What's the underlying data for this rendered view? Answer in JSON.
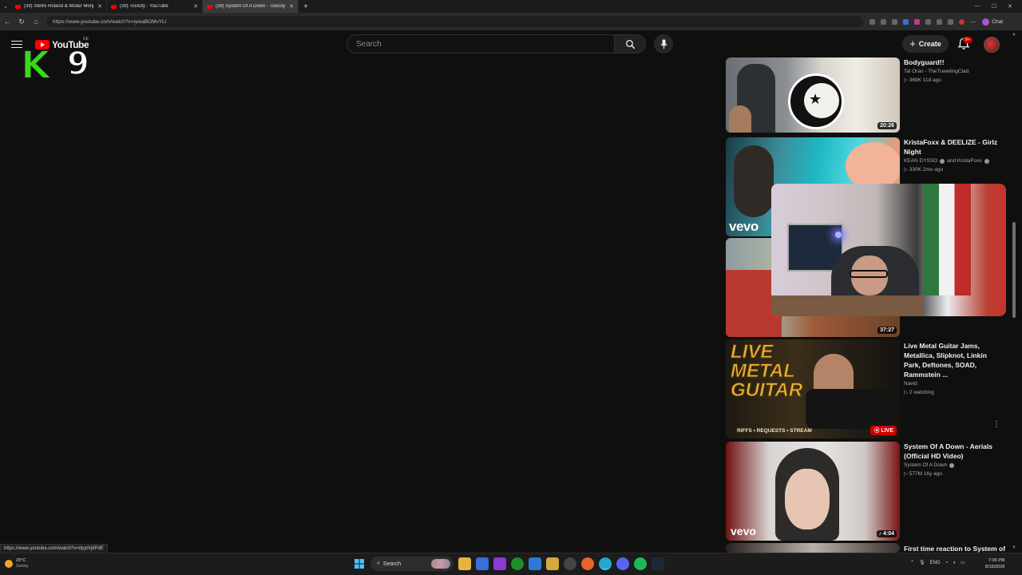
{
  "browser": {
    "tabs": [
      {
        "title": "(39) Stefre Roland & Mister Monj"
      },
      {
        "title": "(39) Toxicity - YouTube"
      },
      {
        "title": "(39) System Of A Down - Toxicity (",
        "active": true
      }
    ],
    "url": "https://www.youtube.com/watch?v=iywaBOMvYLI",
    "chat_label": "Chat"
  },
  "youtube": {
    "logo_text": "YouTube",
    "region": "DE",
    "overlay_logo": {
      "letter": "K",
      "number": "9"
    },
    "search_placeholder": "Search",
    "create_label": "Create",
    "notifications_badge": "9+"
  },
  "recommendations": [
    {
      "title": "Bodyguard!!",
      "channel": "Tal Oran - TheTravelingClatt",
      "meta": "▷ 369K  11d ago",
      "duration": "20:26"
    },
    {
      "title": "KristaFoxx & DEELIZE - Girlz Night",
      "channel": "KEAN DYSSO",
      "channel2": "and KristaFoxx",
      "meta": "▷ 330K  2mo ago",
      "thumb_text": "vevo"
    },
    {
      "title": "",
      "channel": "",
      "meta": "",
      "duration": "37:27"
    },
    {
      "title": "Live Metal Guitar Jams, Metallica, Slipknot, Linkin Park, Deftones, SOAD, Rammstein ...",
      "channel": "Navid",
      "meta": "▷ 2 watching",
      "live_label": "LIVE",
      "thumb_text": "LIVE METAL GUITAR",
      "thumb_sub": "RIFFS • REQUESTS • STREAM"
    },
    {
      "title": "System Of A Down - Aerials (Official HD Video)",
      "channel": "System Of A Down",
      "meta": "▷ 577M  16y ago",
      "duration": "♪ 4:04",
      "thumb_text": "vevo"
    },
    {
      "title": "First time reaction to System of"
    }
  ],
  "status_url": "https://www.youtube.com/watch?v=iIpytXj8PdE",
  "taskbar": {
    "weather_temp": "20°C",
    "weather_desc": "Sunny",
    "search_label": "Search",
    "lang": "ENG",
    "time": "7:05 PM",
    "date": "8/15/2026"
  },
  "colors": {
    "background": "#0f0f0f",
    "brand_red": "#ff0000",
    "k9_green": "#39d81f"
  }
}
